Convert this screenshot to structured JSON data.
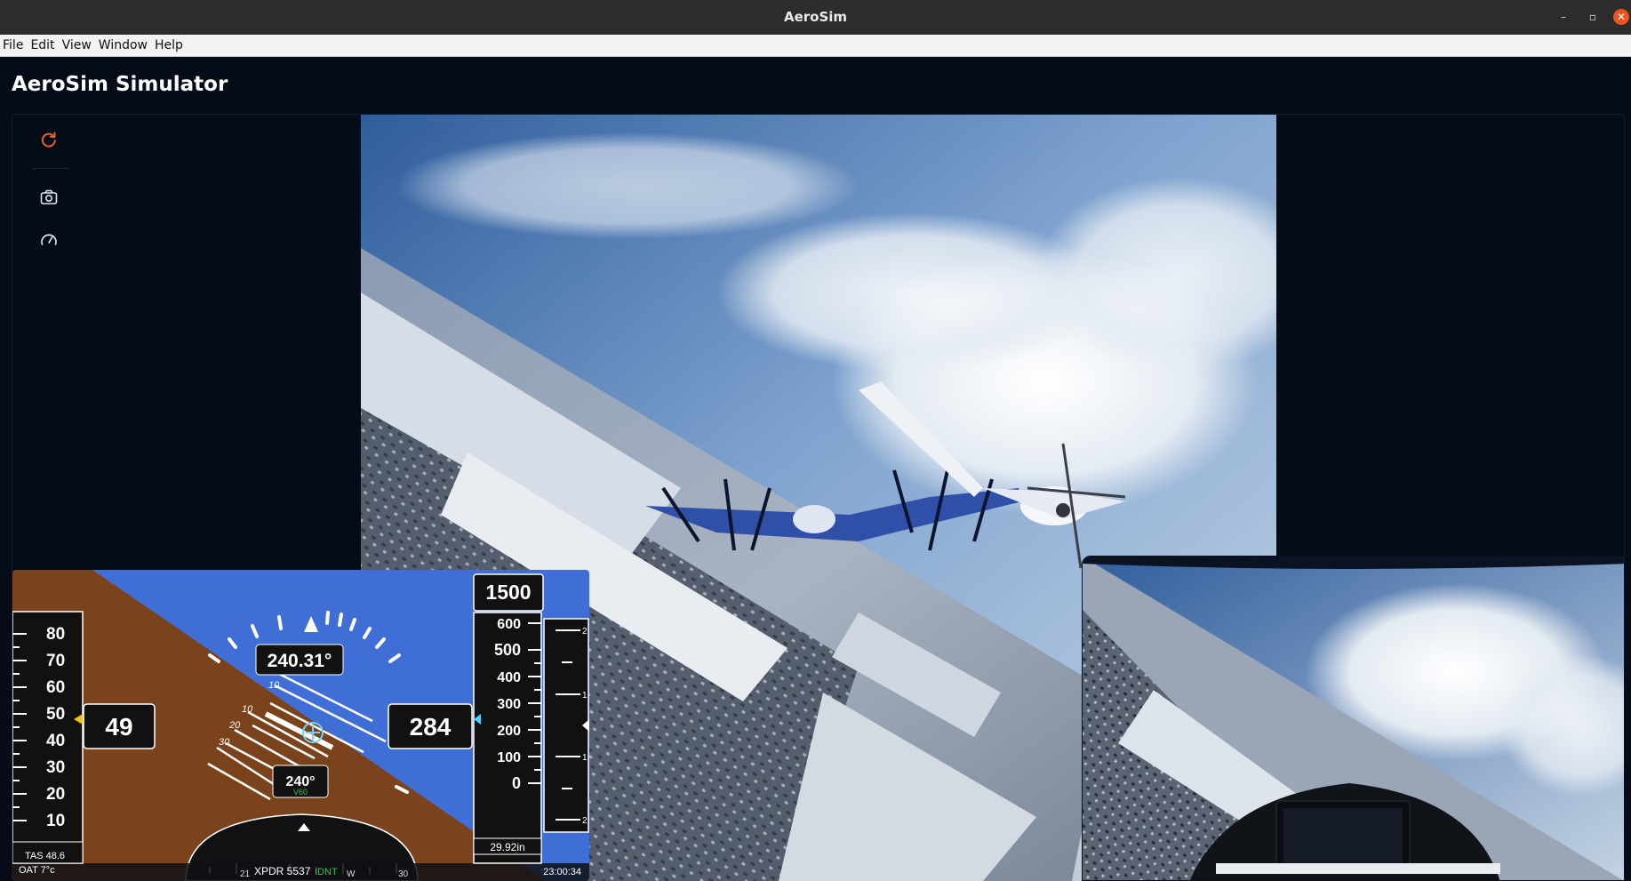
{
  "window": {
    "title": "AeroSim",
    "minimize": "–",
    "maximize": "▫",
    "close": "✕"
  },
  "menu": [
    "File",
    "Edit",
    "View",
    "Window",
    "Help"
  ],
  "app": {
    "title": "AeroSim Simulator"
  },
  "sidebar": {
    "icons": [
      "refresh-icon",
      "camera-icon",
      "gauge-icon"
    ],
    "accent": "#e8612c"
  },
  "pfd": {
    "airspeed_ticks": [
      "80",
      "70",
      "60",
      "50",
      "40",
      "30",
      "20",
      "10"
    ],
    "airspeed": "49",
    "tas": "TAS 48.6",
    "oat": "OAT 7°c",
    "heading_box": "240.31°",
    "pitch_labels": [
      "10",
      "10",
      "20",
      "30"
    ],
    "course": "240°",
    "vsi_under": "V60",
    "altitude_selected": "1500",
    "altitude": "284",
    "altitude_ticks": [
      "600",
      "500",
      "400",
      "300",
      "200",
      "100",
      "0"
    ],
    "baro": "29.92in",
    "vs_ticks": [
      "2",
      "1",
      "1",
      "2"
    ],
    "compass_labels": [
      "21",
      "W",
      "30"
    ],
    "xpdr": "XPDR 5537",
    "ident": "IDNT",
    "time": "23:00:34",
    "sky_color": "#3f6fd6",
    "ground_color": "#7a431c"
  }
}
